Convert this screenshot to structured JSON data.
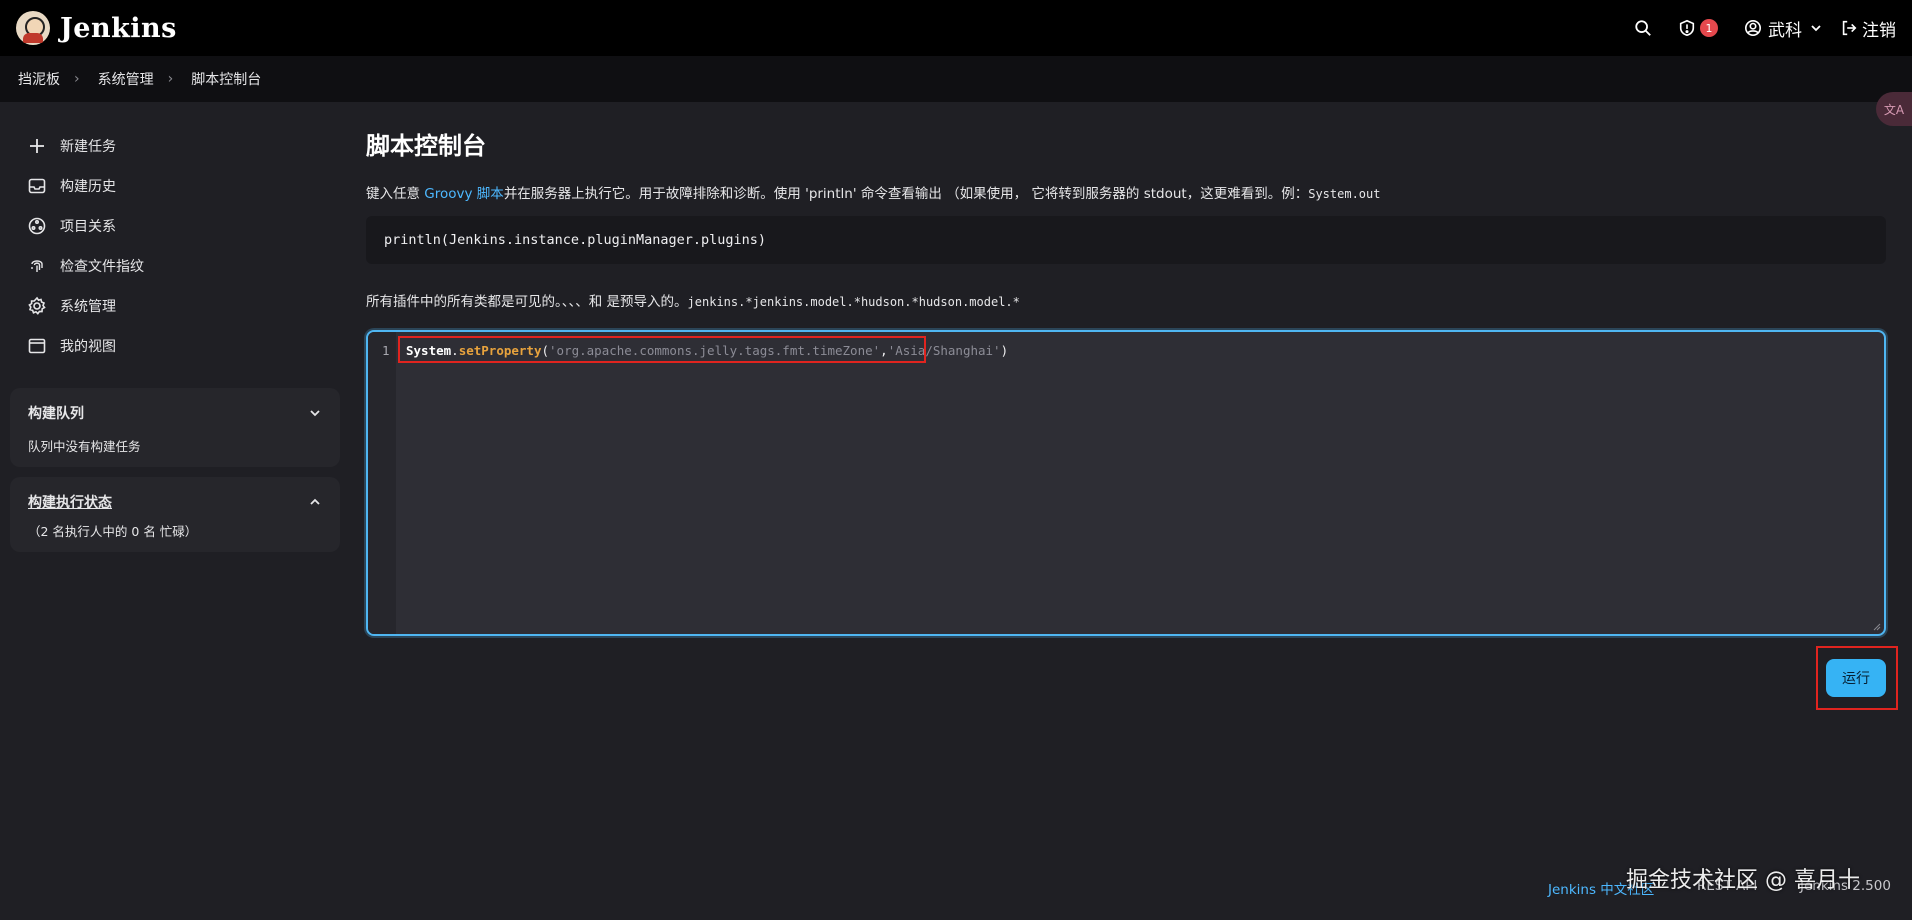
{
  "header": {
    "app_name": "Jenkins",
    "security_badge": "1",
    "user_name": "武科",
    "logout_label": "注销"
  },
  "breadcrumb": [
    "挡泥板",
    "系统管理",
    "脚本控制台"
  ],
  "sidebar": {
    "items": [
      {
        "label": "新建任务",
        "icon": "plus-icon"
      },
      {
        "label": "构建历史",
        "icon": "inbox-icon"
      },
      {
        "label": "项目关系",
        "icon": "relations-icon"
      },
      {
        "label": "检查文件指纹",
        "icon": "fingerprint-icon"
      },
      {
        "label": "系统管理",
        "icon": "gear-icon"
      },
      {
        "label": "我的视图",
        "icon": "window-icon"
      }
    ],
    "build_queue": {
      "title": "构建队列",
      "empty_text": "队列中没有构建任务"
    },
    "executor_status": {
      "title": "构建执行状态",
      "summary": "（2 名执行人中的 0 名 忙碌）"
    }
  },
  "main": {
    "title": "脚本控制台",
    "desc_prefix": "键入任意 ",
    "desc_link": "Groovy 脚本",
    "desc_suffix": "并在服务器上执行它。用于故障排除和诊断。使用 'println' 命令查看输出 （如果使用， 它将转到服务器的 stdout，这更难看到。例：",
    "desc_code": "System.out",
    "example_code": "println(Jenkins.instance.pluginManager.plugins)",
    "imports_prefix": "所有插件中的所有类都是可见的。、、、和 是预导入的。",
    "imports_code": "jenkins.*jenkins.model.*hudson.*hudson.model.*",
    "editor": {
      "line_number": "1",
      "code_obj": "System",
      "code_dot": ".",
      "code_fn": "setProperty",
      "code_open": "(",
      "code_arg1": "'org.apache.commons.jelly.tags.fmt.timeZone'",
      "code_comma": ",",
      "code_arg2": "'Asia/Shanghai'",
      "code_close": ")"
    },
    "run_label": "运行"
  },
  "footer": {
    "link": "Jenkins 中文社区",
    "rest_api": "REST API",
    "version": "Jenkins 2.500"
  },
  "watermark": "掘金技术社区 @ 喜月十",
  "translate_tab": "文A",
  "colors": {
    "accent": "#36b3f4",
    "highlight_red": "#e0241f",
    "badge_red": "#e5484d"
  }
}
